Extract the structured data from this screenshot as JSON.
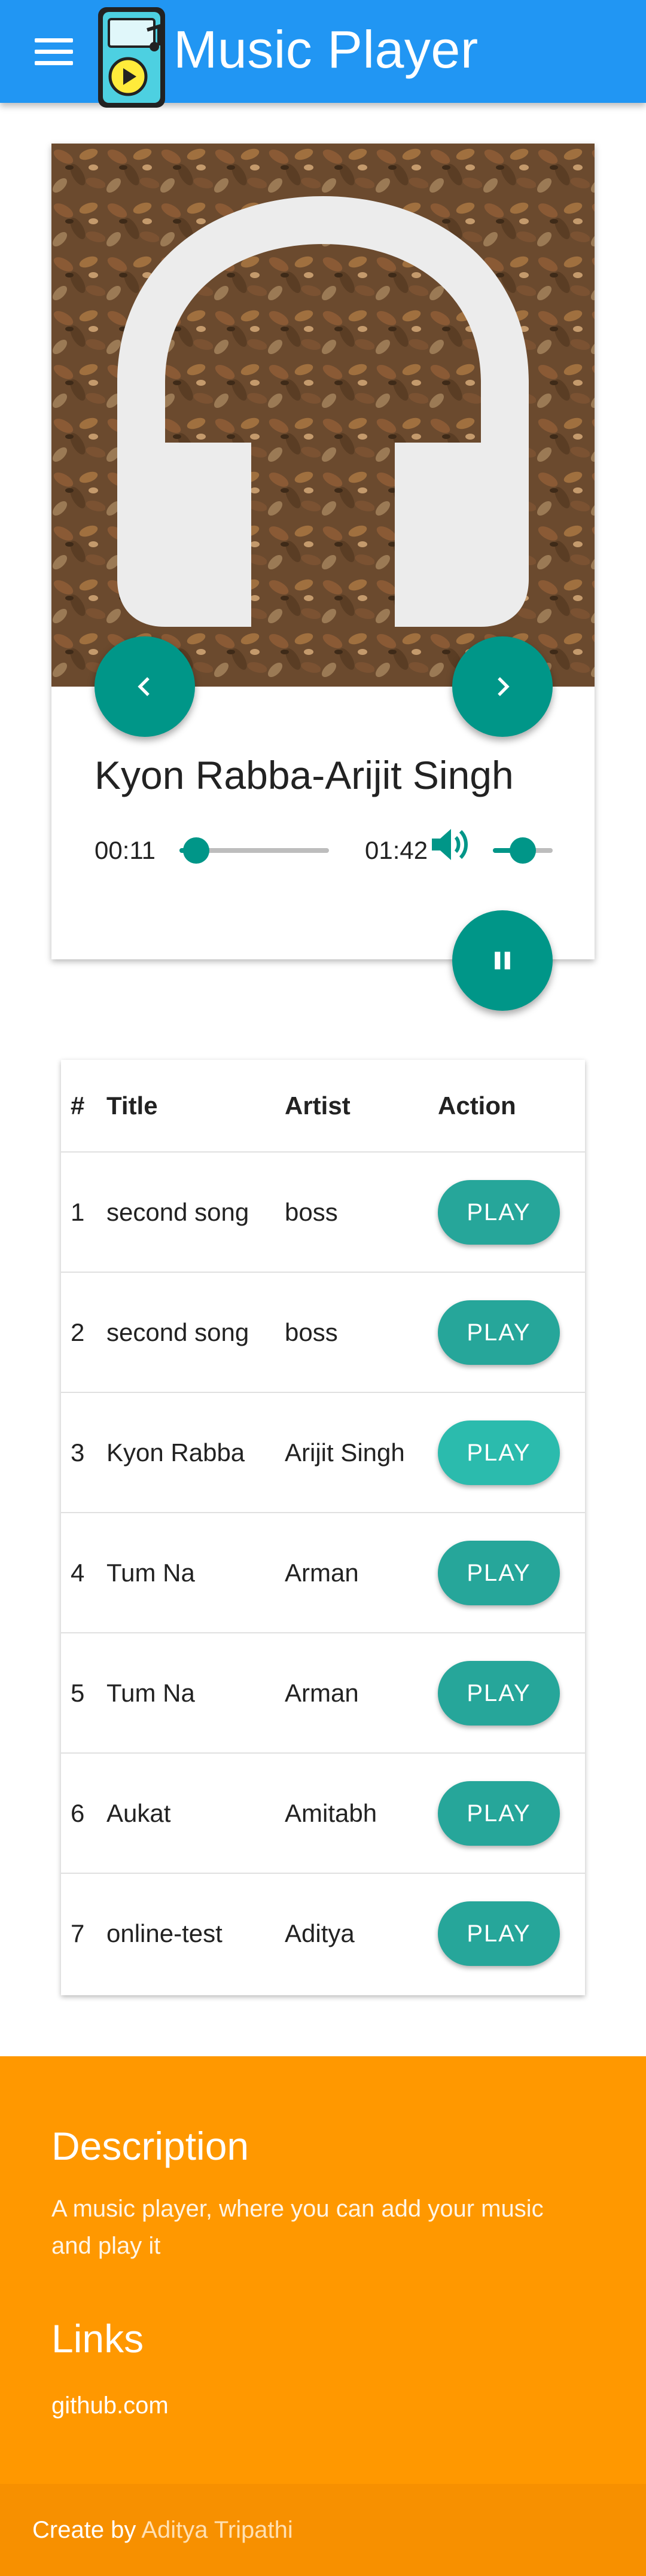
{
  "header": {
    "title": "Music Player",
    "menu_icon": "hamburger-menu-icon",
    "logo_icon": "music-player-device-icon",
    "color": "#2196f3"
  },
  "player": {
    "song_title": "Kyon Rabba-Arijit Singh",
    "current_time": "00:11",
    "duration": "01:42",
    "progress_fraction": 0.11,
    "volume_fraction": 0.5,
    "prev_icon": "chevron-left-icon",
    "next_icon": "chevron-right-icon",
    "pause_icon": "pause-icon",
    "volume_icon": "volume-up-icon",
    "accent_color": "#009688",
    "cover_icon": "headphones-icon"
  },
  "table": {
    "headers": [
      "#",
      "Title",
      "Artist",
      "Action"
    ],
    "rows": [
      {
        "num": "1",
        "title": "second song",
        "artist": "boss",
        "action": "PLAY"
      },
      {
        "num": "2",
        "title": "second song",
        "artist": "boss",
        "action": "PLAY"
      },
      {
        "num": "3",
        "title": "Kyon Rabba",
        "artist": "Arijit Singh",
        "action": "PLAY"
      },
      {
        "num": "4",
        "title": "Tum Na",
        "artist": "Arman",
        "action": "PLAY"
      },
      {
        "num": "5",
        "title": "Tum Na",
        "artist": "Arman",
        "action": "PLAY"
      },
      {
        "num": "6",
        "title": "Aukat",
        "artist": "Amitabh",
        "action": "PLAY"
      },
      {
        "num": "7",
        "title": "online-test",
        "artist": "Aditya",
        "action": "PLAY"
      }
    ],
    "button_color": "#26a69a"
  },
  "footer": {
    "description_heading": "Description",
    "description_text": "A music player, where you can add your music and play it",
    "links_heading": "Links",
    "link_text": "github.com",
    "copyright_prefix": "Create by ",
    "copyright_author": "Aditya Tripathi",
    "color": "#ff9800"
  }
}
